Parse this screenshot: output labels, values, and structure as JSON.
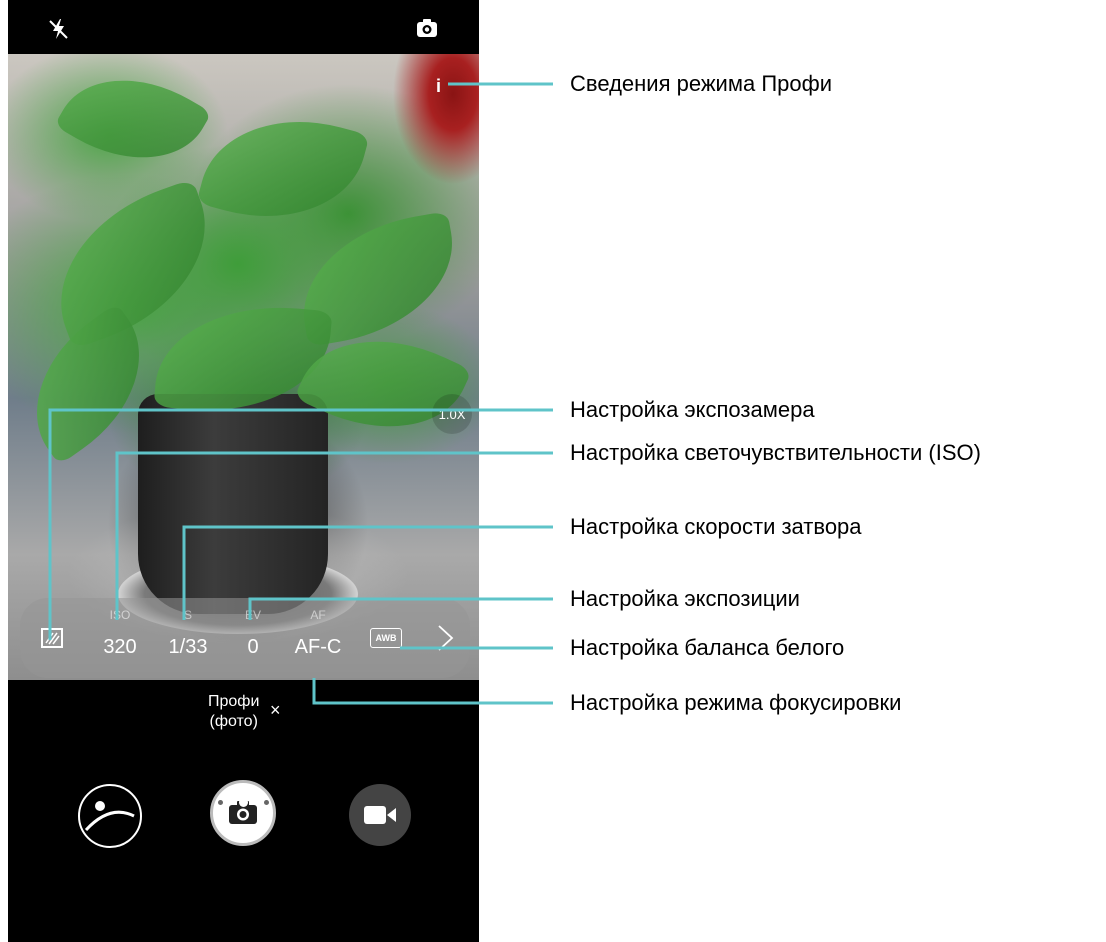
{
  "topbar": {
    "flash_icon": "flash-off-icon",
    "switch_camera_icon": "switch-camera-icon"
  },
  "viewfinder": {
    "info_label": "i",
    "zoom_label": "1.0X"
  },
  "settings": {
    "metering_icon": "metering-icon",
    "iso": {
      "label": "ISO",
      "value": "320"
    },
    "shutter": {
      "label": "S",
      "value": "1/33"
    },
    "ev": {
      "label": "EV",
      "value": "0"
    },
    "af": {
      "label": "AF",
      "value": "AF-C"
    },
    "wb_label": "AWB",
    "expand_icon": "chevron-right-icon"
  },
  "mode": {
    "line1": "Профи",
    "line2": "(фото)",
    "close": "×"
  },
  "controls": {
    "gallery_icon": "gallery-icon",
    "shutter_icon": "camera-icon",
    "video_icon": "video-icon"
  },
  "callouts": [
    "Сведения режима Профи",
    "Настройка экспозамера",
    "Настройка светочувствительности (ISO)",
    "Настройка скорости затвора",
    "Настройка экспозиции",
    "Настройка баланса белого",
    "Настройка режима фокусировки"
  ],
  "colors": {
    "accent": "#5fc4c9",
    "phone_bg": "#000000",
    "text": "#000000"
  }
}
